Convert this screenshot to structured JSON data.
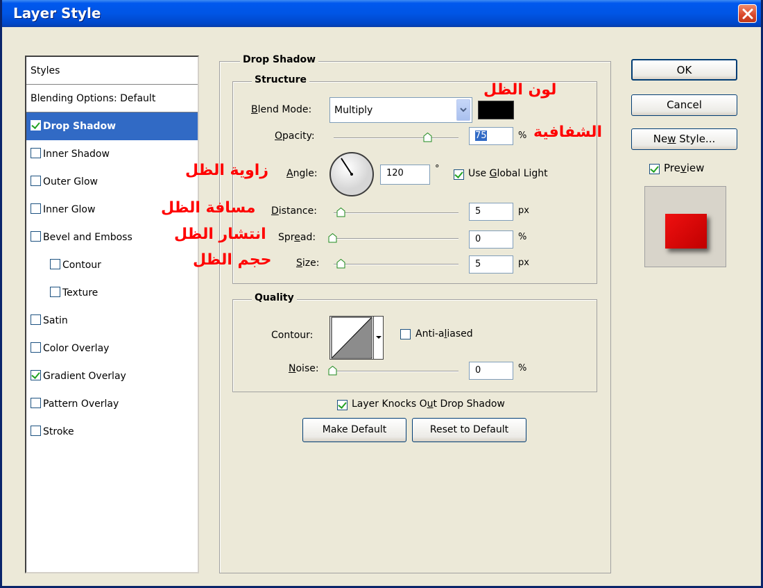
{
  "window": {
    "title": "Layer Style"
  },
  "styles_list": {
    "header": "Styles",
    "blending": "Blending Options: Default",
    "items": [
      {
        "label": "Drop Shadow",
        "checked": true,
        "selected": true
      },
      {
        "label": "Inner Shadow",
        "checked": false
      },
      {
        "label": "Outer Glow",
        "checked": false
      },
      {
        "label": "Inner Glow",
        "checked": false
      },
      {
        "label": "Bevel and Emboss",
        "checked": false
      },
      {
        "label": "Contour",
        "checked": false,
        "sub": true
      },
      {
        "label": "Texture",
        "checked": false,
        "sub": true
      },
      {
        "label": "Satin",
        "checked": false
      },
      {
        "label": "Color Overlay",
        "checked": false
      },
      {
        "label": "Gradient Overlay",
        "checked": true
      },
      {
        "label": "Pattern Overlay",
        "checked": false
      },
      {
        "label": "Stroke",
        "checked": false
      }
    ]
  },
  "drop_shadow": {
    "title": "Drop Shadow",
    "structure": {
      "title": "Structure",
      "blend_mode_label_b": "B",
      "blend_mode_label_rest": "lend Mode:",
      "blend_mode_value": "Multiply",
      "shadow_color": "#000000",
      "opacity_label_o": "O",
      "opacity_label_rest": "pacity:",
      "opacity_value": "75",
      "opacity_unit": "%",
      "opacity_fraction": 0.75,
      "angle_label_a": "A",
      "angle_label_rest": "ngle:",
      "angle_value": "120",
      "angle_unit": "°",
      "use_global_light_pre": "Use ",
      "use_global_light_g": "G",
      "use_global_light_rest": "lobal Light",
      "distance_label_d": "D",
      "distance_label_rest": "istance:",
      "distance_value": "5",
      "distance_unit": "px",
      "spread_label_pre": "Spr",
      "spread_label_e": "e",
      "spread_label_rest": "ad:",
      "spread_value": "0",
      "spread_unit": "%",
      "size_label_s": "S",
      "size_label_rest": "ize:",
      "size_value": "5",
      "size_unit": "px"
    },
    "quality": {
      "title": "Quality",
      "contour_label": "Contour:",
      "anti_aliased_pre": "Anti-a",
      "anti_aliased_l": "l",
      "anti_aliased_rest": "iased",
      "noise_label_n": "N",
      "noise_label_rest": "oise:",
      "noise_value": "0",
      "noise_unit": "%"
    },
    "knocks_out_pre": "Layer Knocks O",
    "knocks_out_u": "u",
    "knocks_out_rest": "t Drop Shadow",
    "make_default": "Make Default",
    "reset_default": "Reset to Default"
  },
  "annotations": {
    "color": "لون الظل",
    "opacity": "الشفافية",
    "angle": "زاوية الظل",
    "distance": "مسافة الظل",
    "spread": "انتشار الظل",
    "size": "حجم الظل"
  },
  "buttons": {
    "ok": "OK",
    "cancel": "Cancel",
    "new_style_pre": "Ne",
    "new_style_w": "w",
    "new_style_rest": " Style...",
    "preview_pre": "Pre",
    "preview_v": "v",
    "preview_rest": "iew"
  },
  "colors": {
    "accent": "#316ac5",
    "annotation": "#ff0000",
    "title_bar": "#0055e5"
  }
}
